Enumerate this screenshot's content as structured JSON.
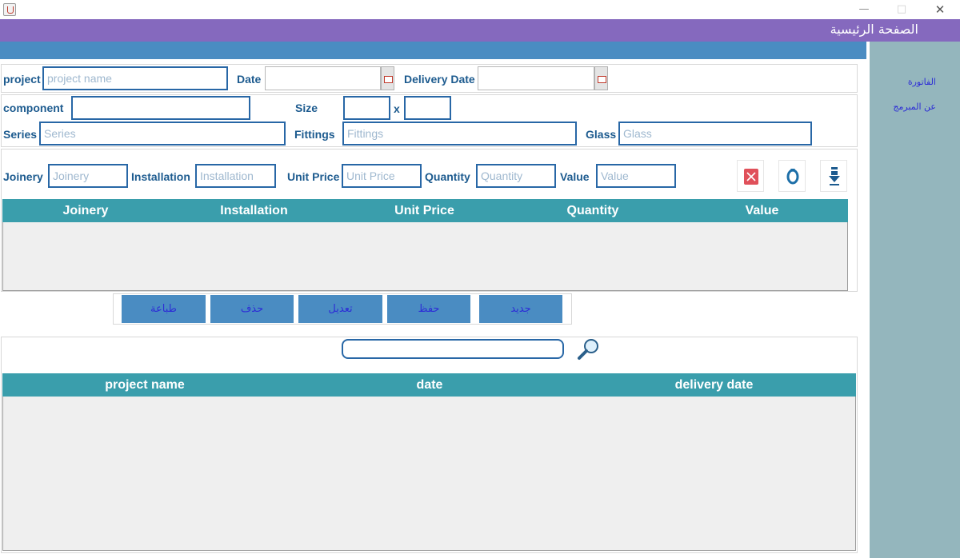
{
  "window": {
    "minimize": "—",
    "maximize": "□",
    "close": "✕"
  },
  "header": {
    "title": "الصفحة الرئيسية"
  },
  "sidebar": {
    "items": [
      {
        "label": "الفاتورة"
      },
      {
        "label": "عن المبرمج"
      }
    ]
  },
  "project_row": {
    "project_label": "project",
    "project_placeholder": "project name",
    "date_label": "Date",
    "delivery_label": "Delivery Date"
  },
  "component_row": {
    "component_label": "component",
    "size_label": "Size",
    "x_label": "x",
    "series_label": "Series",
    "series_placeholder": "Series",
    "fittings_label": "Fittings",
    "fittings_placeholder": "Fittings",
    "glass_label": "Glass",
    "glass_placeholder": "Glass"
  },
  "costs_row": {
    "joinery_label": "Joinery",
    "joinery_placeholder": "Joinery",
    "installation_label": "Installation",
    "installation_placeholder": "Installation",
    "unit_price_label": "Unit Price",
    "unit_price_placeholder": "Unit Price",
    "quantity_label": "Quantity",
    "quantity_placeholder": "Quantity",
    "value_label": "Value",
    "value_placeholder": "Value"
  },
  "icons": {
    "delete": "delete-icon",
    "refresh": "refresh-icon",
    "download": "download-icon",
    "search": "search-icon"
  },
  "items_table": {
    "columns": [
      "Joinery",
      "Installation",
      "Unit Price",
      "Quantity",
      "Value"
    ]
  },
  "actions": {
    "print": "طباعة",
    "delete": "حذف",
    "edit": "تعديل",
    "save": "حفظ",
    "new": "جديد"
  },
  "projects_table": {
    "columns": [
      "project name",
      "date",
      "delivery date"
    ]
  },
  "colors": {
    "header": "#8569be",
    "bar": "#4a8cc2",
    "sidebar": "#94b6bd",
    "table_header": "#3a9eac",
    "input_border": "#2867a6"
  }
}
